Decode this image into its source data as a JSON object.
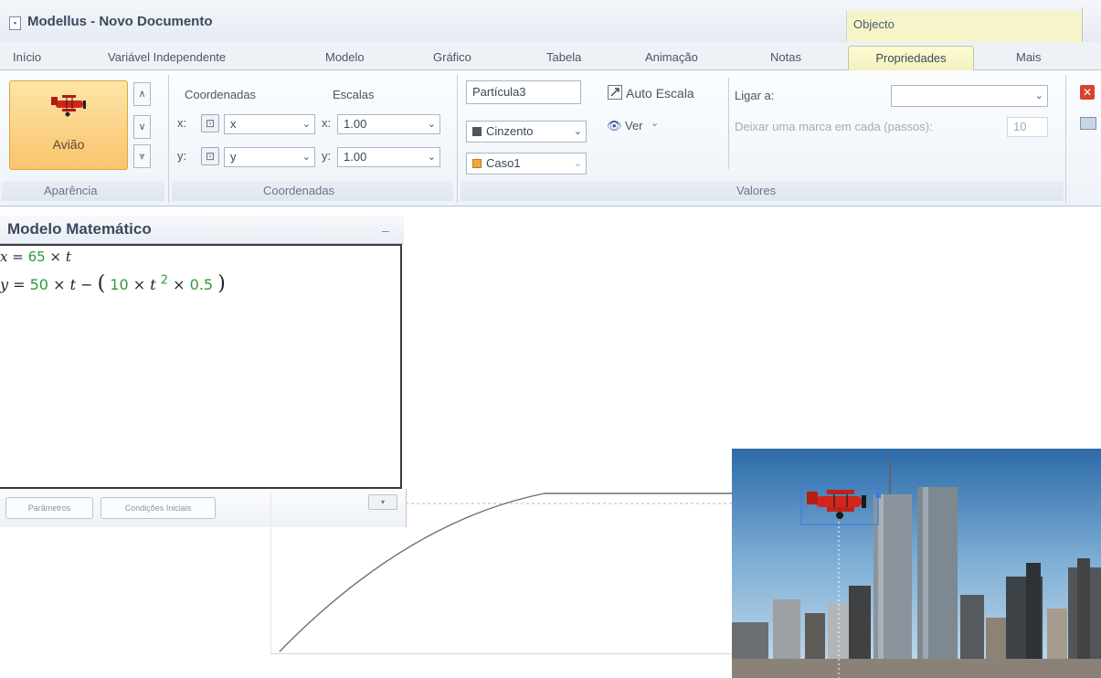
{
  "window": {
    "title": "Modellus - Novo Documento",
    "context_group": "Objecto"
  },
  "tabs": [
    "Início",
    "Variável Independente",
    "Modelo",
    "Gráfico",
    "Tabela",
    "Animação",
    "Notas",
    "Propriedades",
    "Mais"
  ],
  "active_tab": "Propriedades",
  "ribbon": {
    "aparencia": {
      "object_label": "Avião",
      "group_label": "Aparência"
    },
    "coordenadas": {
      "header_coords": "Coordenadas",
      "header_scales": "Escalas",
      "x_prefix": "x:",
      "y_prefix": "y:",
      "x_var": "x",
      "y_var": "y",
      "x_scale": "1.00",
      "y_scale": "1.00",
      "group_label": "Coordenadas"
    },
    "valores": {
      "particle": "Partícula3",
      "color": "Cinzento",
      "color_hex": "#555555",
      "case": "Caso1",
      "case_hex": "#f2a63a",
      "auto_scale": "Auto Escala",
      "view": "Ver",
      "link_label": "Ligar a:",
      "link_value": "",
      "mark_label": "Deixar uma marca em cada (passos):",
      "mark_value": "10",
      "group_label": "Valores"
    }
  },
  "math_model": {
    "title": "Modelo Matemático",
    "minimize": "–",
    "eq1": {
      "var": "x",
      "coef": "65",
      "op": "×",
      "t": "t"
    },
    "eq2": {
      "var": "y",
      "coef1": "50",
      "op": "×",
      "t": "t",
      "minus": "−",
      "coef2": "10",
      "exp": "2",
      "coef3": "0.5"
    },
    "btn_params": "Parâmetros",
    "btn_initial": "Condições Iniciais",
    "expand": "▾"
  }
}
